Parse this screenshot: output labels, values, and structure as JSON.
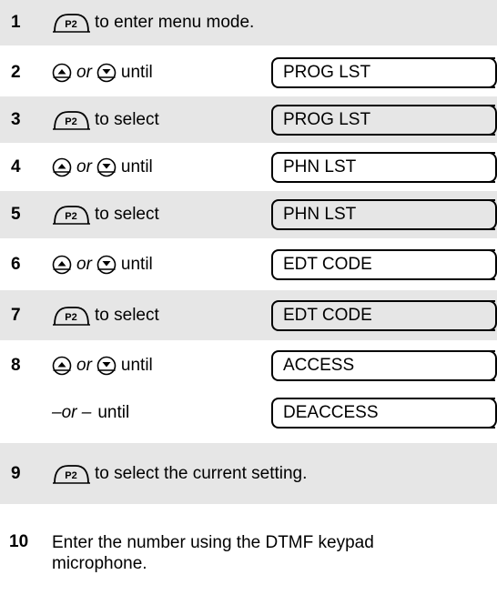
{
  "steps": [
    {
      "num": "1",
      "text": "to enter menu mode."
    },
    {
      "num": "2",
      "or": "or",
      "until": "until",
      "display": "PROG LST"
    },
    {
      "num": "3",
      "text": "to select",
      "display": "PROG LST"
    },
    {
      "num": "4",
      "or": "or",
      "until": "until",
      "display": "PHN LST"
    },
    {
      "num": "5",
      "text": "to select",
      "display": "PHN LST"
    },
    {
      "num": "6",
      "or": "or",
      "until": "until",
      "display": "EDT CODE"
    },
    {
      "num": "7",
      "text": "to select",
      "display": "EDT CODE"
    },
    {
      "num": "8",
      "or": "or",
      "until": "until",
      "display": "ACCESS"
    },
    {
      "alt_dash_or": "–or –",
      "alt_until": "until",
      "display": "DEACCESS"
    },
    {
      "num": "9",
      "text": "to select the current setting."
    },
    {
      "num": "10",
      "line1": "Enter the number using the DTMF keypad",
      "line2": "microphone."
    }
  ],
  "icons": {
    "p2_key": "P2",
    "up_key": "up-arrow-key-icon",
    "down_key": "down-arrow-key-icon"
  },
  "colors": {
    "shade": "#e6e6e6"
  }
}
